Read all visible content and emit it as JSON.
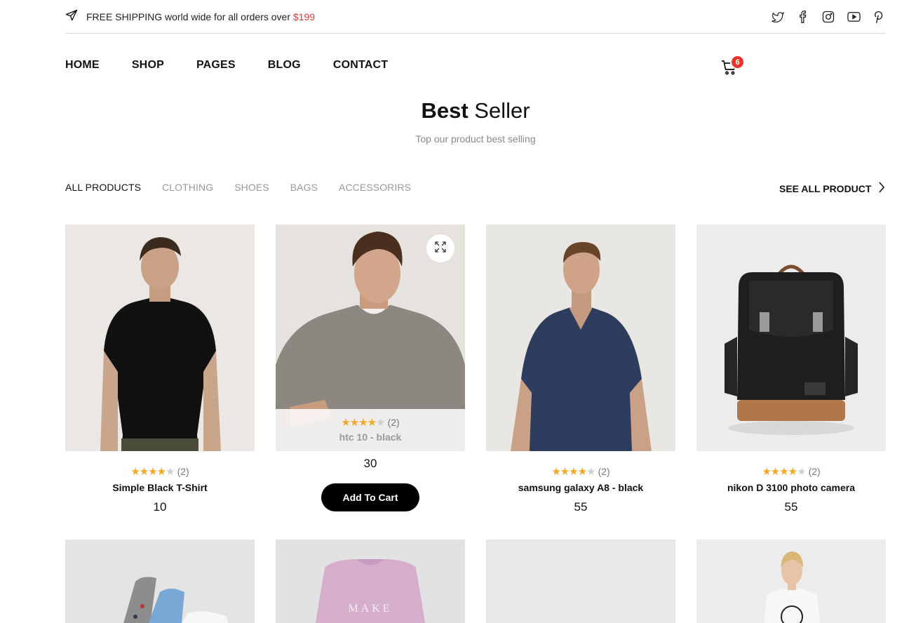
{
  "topbar": {
    "shipping_text": "FREE SHIPPING world wide for all orders over",
    "shipping_price": "$199",
    "social": [
      "twitter-icon",
      "facebook-icon",
      "instagram-icon",
      "youtube-icon",
      "pinterest-icon"
    ]
  },
  "nav": {
    "items": [
      "HOME",
      "SHOP",
      "PAGES",
      "BLOG",
      "CONTACT"
    ],
    "cart_count": "6"
  },
  "section": {
    "title_bold": "Best",
    "title_light": "Seller",
    "subtitle": "Top our product best selling"
  },
  "tabs": {
    "items": [
      "ALL PRODUCTS",
      "CLOTHING",
      "SHOES",
      "BAGS",
      "ACCESSORIRS"
    ],
    "see_all": "SEE ALL PRODUCT"
  },
  "products": [
    {
      "name": "Simple Black T-Shirt",
      "price": "10",
      "reviews": "(2)",
      "rating": 4
    },
    {
      "name": "htc 10 - black",
      "price": "30",
      "reviews": "(2)",
      "rating": 4,
      "button": "Add To Cart"
    },
    {
      "name": "samsung galaxy A8 - black",
      "price": "55",
      "reviews": "(2)",
      "rating": 4
    },
    {
      "name": "nikon D 3100 photo camera",
      "price": "55",
      "reviews": "(2)",
      "rating": 4
    }
  ],
  "colors": {
    "accent_red": "#e53935",
    "star": "#f5a623",
    "button_bg": "#000000"
  }
}
